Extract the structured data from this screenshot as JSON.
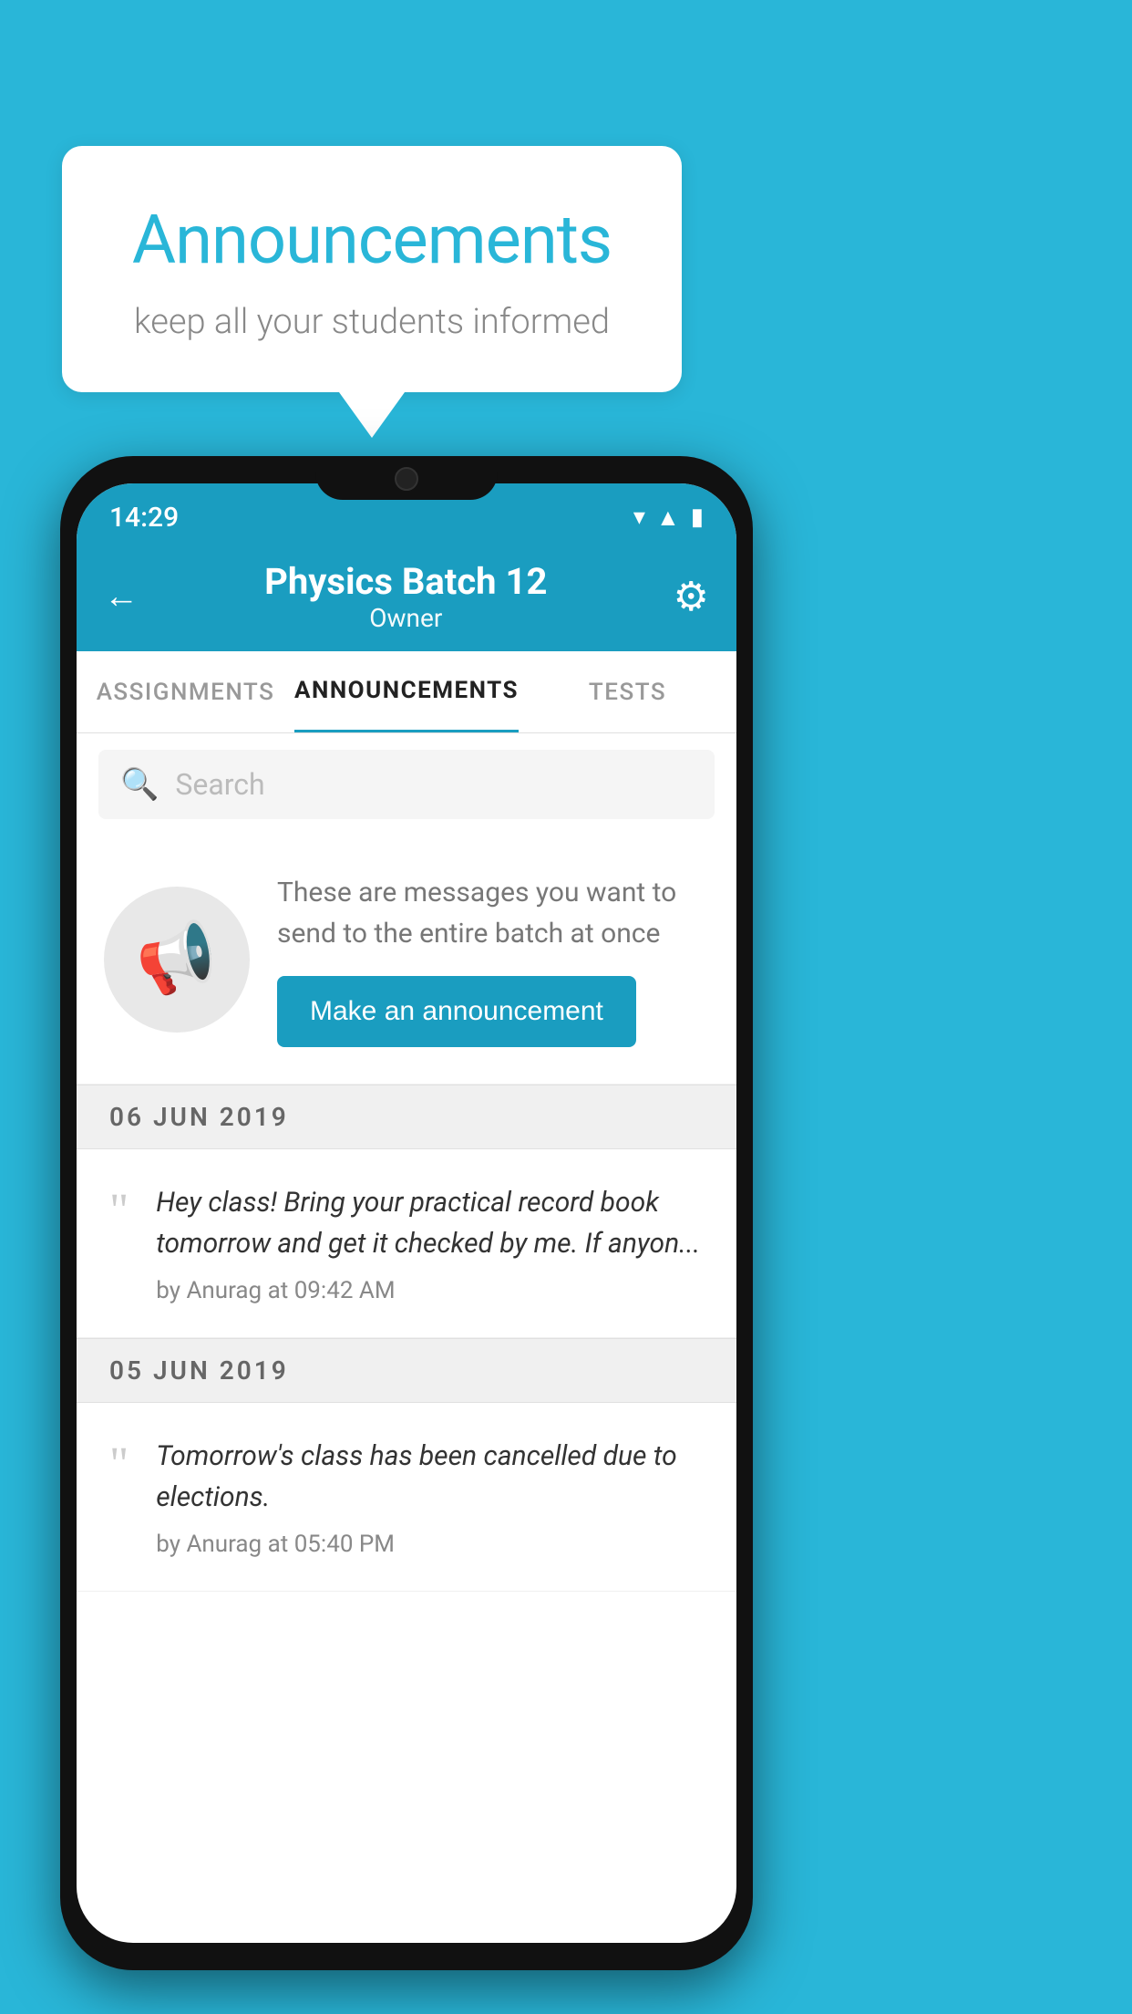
{
  "bubble": {
    "title": "Announcements",
    "subtitle": "keep all your students informed"
  },
  "phone": {
    "statusBar": {
      "time": "14:29"
    },
    "header": {
      "title": "Physics Batch 12",
      "subtitle": "Owner",
      "backLabel": "←",
      "gearLabel": "⚙"
    },
    "tabs": [
      {
        "label": "ASSIGNMENTS",
        "active": false
      },
      {
        "label": "ANNOUNCEMENTS",
        "active": true
      },
      {
        "label": "TESTS",
        "active": false
      }
    ],
    "search": {
      "placeholder": "Search"
    },
    "promoCard": {
      "description": "These are messages you want to send to the entire batch at once",
      "buttonLabel": "Make an announcement"
    },
    "announcements": [
      {
        "date": "06  JUN  2019",
        "text": "Hey class! Bring your practical record book tomorrow and get it checked by me. If anyon...",
        "meta": "by Anurag at 09:42 AM"
      },
      {
        "date": "05  JUN  2019",
        "text": "Tomorrow's class has been cancelled due to elections.",
        "meta": "by Anurag at 05:40 PM"
      }
    ]
  }
}
